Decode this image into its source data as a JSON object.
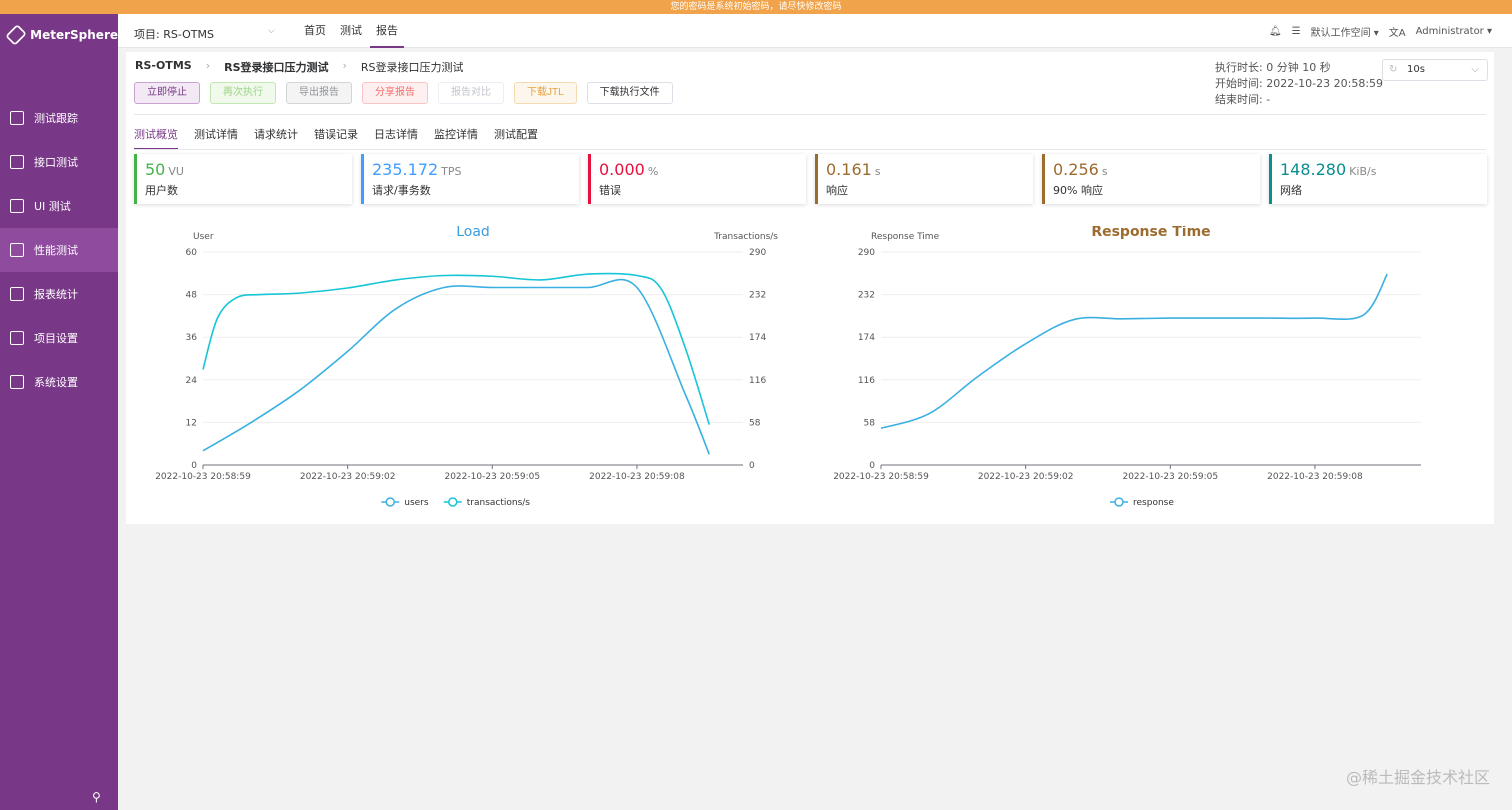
{
  "banner": "您的密码是系统初始密码，请尽快修改密码",
  "app": {
    "name": "MeterSphere"
  },
  "sidebar": {
    "items": [
      {
        "label": "测试跟踪",
        "icon": "clipboard-icon"
      },
      {
        "label": "接口测试",
        "icon": "api-icon"
      },
      {
        "label": "UI 测试",
        "icon": "ui-icon"
      },
      {
        "label": "性能测试",
        "icon": "performance-icon"
      },
      {
        "label": "报表统计",
        "icon": "report-icon"
      },
      {
        "label": "项目设置",
        "icon": "folder-icon"
      },
      {
        "label": "系统设置",
        "icon": "gear-icon"
      }
    ],
    "active_index": 3
  },
  "topbar": {
    "project": "项目: RS-OTMS",
    "nav": [
      "首页",
      "测试",
      "报告"
    ],
    "workspace": "默认工作空间",
    "user": "Administrator"
  },
  "breadcrumb": [
    "RS-OTMS",
    "RS登录接口压力测试",
    "RS登录接口压力测试"
  ],
  "actions": [
    "立即停止",
    "再次执行",
    "导出报告",
    "分享报告",
    "报告对比",
    "下载JTL",
    "下载执行文件"
  ],
  "meta": {
    "duration_label": "执行时长:",
    "duration": "0 分钟 10 秒",
    "start_label": "开始时间:",
    "start": "2022-10-23 20:58:59",
    "end_label": "结束时间:",
    "end": "-"
  },
  "refresh": "10s",
  "tabs": [
    "测试概览",
    "测试详情",
    "请求统计",
    "错误记录",
    "日志详情",
    "监控详情",
    "测试配置"
  ],
  "stats": [
    {
      "value": "50",
      "unit": "VU",
      "label": "用户数",
      "color": "#44b349"
    },
    {
      "value": "235.172",
      "unit": "TPS",
      "label": "请求/事务数",
      "color": "#409eff"
    },
    {
      "value": "0.000",
      "unit": "%",
      "label": "错误",
      "color": "#e6113c"
    },
    {
      "value": "0.161",
      "unit": "s",
      "label": "响应",
      "color": "#9c6b2e"
    },
    {
      "value": "0.256",
      "unit": "s",
      "label": "90% 响应",
      "color": "#9c6b2e"
    },
    {
      "value": "148.280",
      "unit": "KiB/s",
      "label": "网络",
      "color": "#0a8e8e"
    }
  ],
  "chart_data": [
    {
      "type": "line",
      "title": "Load",
      "ylabel": "User",
      "y2label": "Transactions/s",
      "xticks": [
        "2022-10-23 20:58:59",
        "2022-10-23 20:59:02",
        "2022-10-23 20:59:05",
        "2022-10-23 20:59:08"
      ],
      "yticks": [
        0,
        12,
        24,
        36,
        48,
        60
      ],
      "y2ticks": [
        0,
        58,
        116,
        174,
        232,
        290
      ],
      "ylim": [
        0,
        60
      ],
      "y2lim": [
        0,
        290
      ],
      "series": [
        {
          "name": "users",
          "axis": "left",
          "color": "#3ab0e2",
          "x": [
            0,
            1,
            2,
            3,
            4,
            5,
            6,
            7,
            8,
            9,
            10.0,
            10.5
          ],
          "values": [
            4,
            12,
            21,
            32,
            44,
            50,
            50,
            50,
            50,
            50,
            20,
            3
          ]
        },
        {
          "name": "transactions/s",
          "axis": "right",
          "color": "#16c5d6",
          "x": [
            0,
            0.3,
            0.7,
            1.2,
            2,
            3,
            4,
            5,
            6,
            7,
            8,
            9,
            9.5,
            10.0,
            10.5
          ],
          "values": [
            130,
            200,
            228,
            232,
            234,
            241,
            252,
            258,
            257,
            252,
            260,
            258,
            240,
            160,
            55
          ]
        }
      ]
    },
    {
      "type": "line",
      "title": "Response Time",
      "ylabel": "Response Time",
      "xticks": [
        "2022-10-23 20:58:59",
        "2022-10-23 20:59:02",
        "2022-10-23 20:59:05",
        "2022-10-23 20:59:08"
      ],
      "yticks": [
        0,
        58,
        116,
        174,
        232,
        290
      ],
      "ylim": [
        0,
        290
      ],
      "series": [
        {
          "name": "response",
          "color": "#3ab0e2",
          "x": [
            0,
            1,
            2,
            3,
            4,
            5,
            6,
            7,
            8,
            9,
            10,
            10.5
          ],
          "values": [
            50,
            70,
            120,
            165,
            198,
            199,
            200,
            200,
            200,
            200,
            204,
            260
          ]
        }
      ]
    }
  ],
  "watermark": "@稀土掘金技术社区"
}
